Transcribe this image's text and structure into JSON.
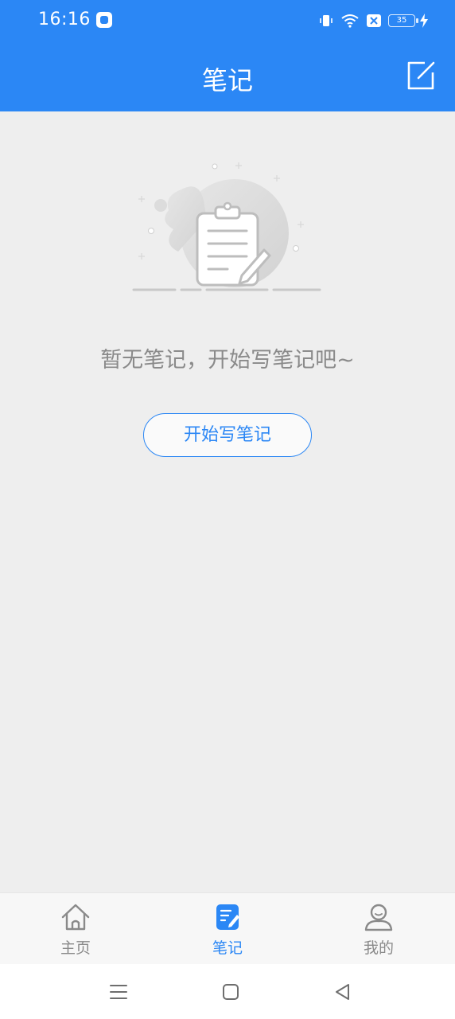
{
  "status_bar": {
    "time": "16:16",
    "battery_level": "35"
  },
  "header": {
    "title": "笔记"
  },
  "empty_state": {
    "message": "暂无笔记，开始写笔记吧~",
    "button_label": "开始写笔记"
  },
  "tabs": [
    {
      "label": "主页",
      "icon": "home-icon",
      "active": false
    },
    {
      "label": "笔记",
      "icon": "note-icon",
      "active": true
    },
    {
      "label": "我的",
      "icon": "user-icon",
      "active": false
    }
  ],
  "colors": {
    "primary": "#2b87f5",
    "background": "#eeeeee",
    "text_muted": "#8a8a8a"
  }
}
